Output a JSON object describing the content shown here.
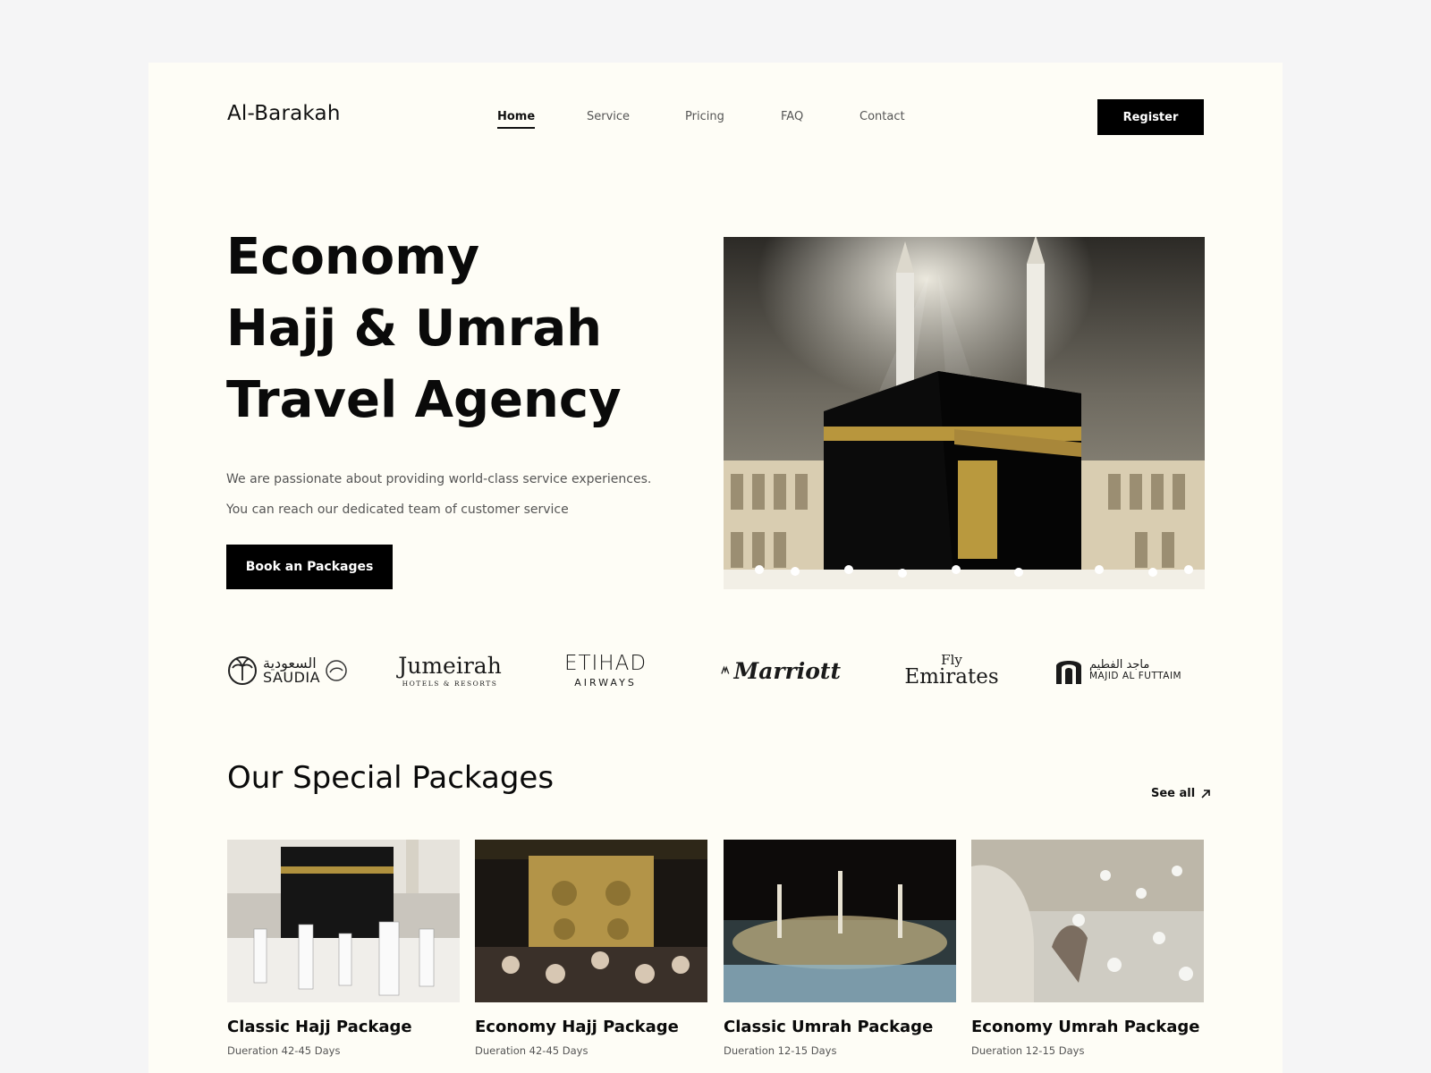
{
  "brand": {
    "name": "Al-Barakah"
  },
  "nav": {
    "items": [
      {
        "label": "Home",
        "active": true
      },
      {
        "label": "Service"
      },
      {
        "label": "Pricing"
      },
      {
        "label": "FAQ"
      },
      {
        "label": "Contact"
      }
    ],
    "register_label": "Register"
  },
  "hero": {
    "title_lines": [
      "Economy",
      "Hajj & Umrah",
      "Travel Agency"
    ],
    "description_lines": [
      "We are passionate about providing world-class service experiences.",
      "You can reach our dedicated team of customer service"
    ],
    "cta_label": "Book an Packages",
    "image": "kaaba-mecca-photo"
  },
  "partners": [
    {
      "arabic": "السعودية",
      "name": "SAUDIA",
      "logo": "saudia-logo"
    },
    {
      "name": "Jumeirah",
      "tagline": "HOTELS & RESORTS",
      "logo": "jumeirah-logo"
    },
    {
      "name": "ETIHAD",
      "tagline": "AIRWAYS",
      "logo": "etihad-logo"
    },
    {
      "name": "Marriott",
      "logo": "marriott-logo"
    },
    {
      "name": "Emirates",
      "tagline": "Fly",
      "logo": "emirates-logo"
    },
    {
      "arabic": "ماجد الفطيم",
      "name": "MAJID AL FUTTAIM",
      "logo": "majid-al-futtaim-logo"
    }
  ],
  "packages": {
    "title": "Our Special Packages",
    "see_all_label": "See all",
    "items": [
      {
        "name": "Classic Hajj Package",
        "duration": "Dueration 42-45 Days",
        "image": "kaaba-pilgrims-photo"
      },
      {
        "name": "Economy Hajj Package",
        "duration": "Dueration 42-45 Days",
        "image": "kaaba-door-photo"
      },
      {
        "name": "Classic Umrah Package",
        "duration": "Dueration 12-15 Days",
        "image": "mosque-night-photo"
      },
      {
        "name": "Economy Umrah Package",
        "duration": "Dueration 12-15 Days",
        "image": "pilgrims-prayer-photo"
      }
    ]
  },
  "colors": {
    "page_background": "#f5f5f6",
    "canvas_background": "#fefdf6",
    "primary_button": "#000000",
    "text_primary": "#0a0a0a",
    "text_secondary": "#555555"
  }
}
